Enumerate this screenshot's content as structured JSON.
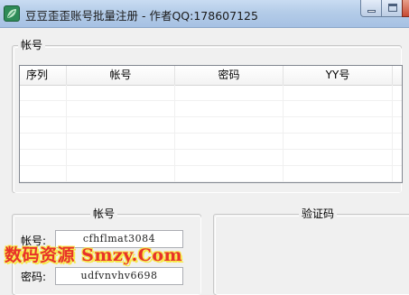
{
  "window": {
    "title": "豆豆歪歪账号批量注册 - 作者QQ:178607125",
    "icon": "app-leaf-icon"
  },
  "account_list_group": {
    "title": "帐号",
    "columns": [
      "序列",
      "帐号",
      "密码",
      "YY号"
    ],
    "rows": []
  },
  "account_form": {
    "title": "帐号",
    "account_label": "帐号:",
    "account_value": "cfhflmat3084",
    "password_label": "密码:",
    "password_value": "udfvnvhv6698"
  },
  "captcha_group": {
    "title": "验证码"
  },
  "watermark": {
    "text": "数码资源 Smzy.Com"
  },
  "colors": {
    "titlebar": "#b4cce8",
    "window_bg": "#f0f0f0",
    "watermark": "#e8322a",
    "watermark_outline": "#f7e84a"
  }
}
